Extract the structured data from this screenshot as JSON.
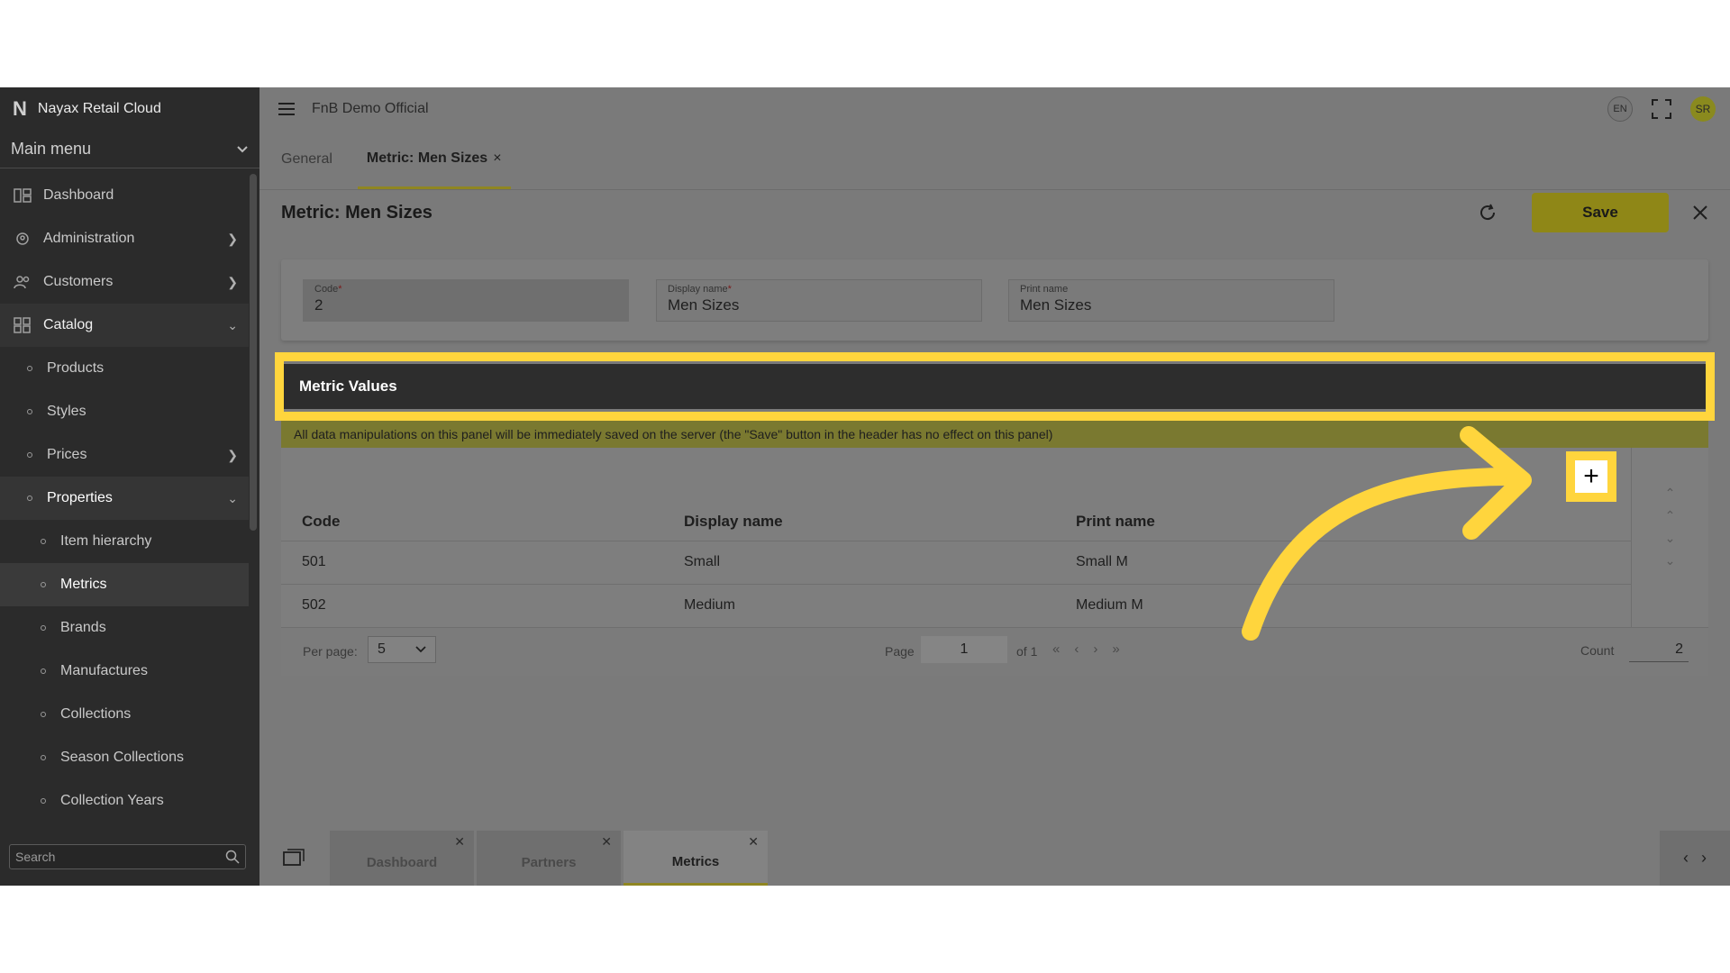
{
  "sidebar": {
    "brand": "Nayax Retail Cloud",
    "main_menu": "Main menu",
    "items": [
      {
        "label": "Dashboard"
      },
      {
        "label": "Administration"
      },
      {
        "label": "Customers"
      },
      {
        "label": "Catalog"
      },
      {
        "label": "Products"
      },
      {
        "label": "Styles"
      },
      {
        "label": "Prices"
      },
      {
        "label": "Properties"
      },
      {
        "label": "Item hierarchy"
      },
      {
        "label": "Metrics"
      },
      {
        "label": "Brands"
      },
      {
        "label": "Manufactures"
      },
      {
        "label": "Collections"
      },
      {
        "label": "Season Collections"
      },
      {
        "label": "Collection Years"
      }
    ],
    "search_placeholder": "Search"
  },
  "header": {
    "org": "FnB Demo Official",
    "lang": "EN",
    "user_initials": "SR"
  },
  "tabs": [
    {
      "label": "General"
    },
    {
      "label": "Metric: Men Sizes"
    }
  ],
  "page": {
    "title": "Metric: Men Sizes",
    "save_label": "Save"
  },
  "form": {
    "code_label": "Code",
    "code_value": "2",
    "display_label": "Display name",
    "display_value": "Men Sizes",
    "print_label": "Print name",
    "print_value": "Men Sizes",
    "required_mark": "*"
  },
  "metric_values": {
    "title": "Metric Values",
    "info": "All data manipulations on this panel will be immediately saved on the server (the \"Save\" button in the header has no effect on this panel)",
    "columns": [
      "Code",
      "Display name",
      "Print name"
    ],
    "rows": [
      {
        "code": "501",
        "display": "Small",
        "print": "Small M"
      },
      {
        "code": "502",
        "display": "Medium",
        "print": "Medium M"
      }
    ],
    "per_page_label": "Per page:",
    "per_page_value": "5",
    "page_label": "Page",
    "page_value": "1",
    "of_label": "of 1",
    "count_label": "Count",
    "count_value": "2"
  },
  "bottom_tabs": [
    {
      "label": "Dashboard"
    },
    {
      "label": "Partners"
    },
    {
      "label": "Metrics"
    }
  ],
  "colors": {
    "highlight": "#ffd53d",
    "accent": "#8f8717"
  }
}
